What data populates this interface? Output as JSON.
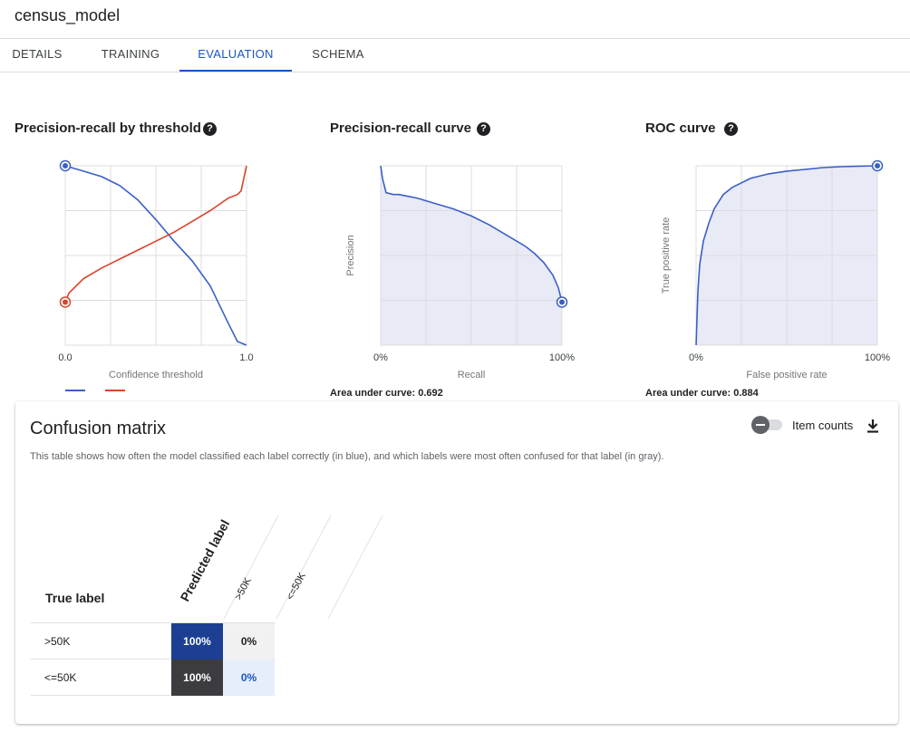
{
  "app": {
    "title": "census_model"
  },
  "tabs": [
    {
      "label": "DETAILS",
      "active": false
    },
    {
      "label": "TRAINING",
      "active": false
    },
    {
      "label": "EVALUATION",
      "active": true
    },
    {
      "label": "SCHEMA",
      "active": false
    }
  ],
  "charts": {
    "pr_threshold": {
      "title": "Precision-recall by threshold",
      "xlabel": "Confidence threshold",
      "x_min_label": "0.0",
      "x_max_label": "1.0",
      "legend_colors": [
        "#3b5fc6",
        "#d8442b"
      ]
    },
    "pr_curve": {
      "title": "Precision-recall curve",
      "xlabel": "Recall",
      "ylabel": "Precision",
      "x_min_label": "0%",
      "x_max_label": "100%",
      "auc_text": "Area under curve: 0.692"
    },
    "roc": {
      "title": "ROC curve",
      "xlabel": "False positive rate",
      "ylabel": "True positive rate",
      "x_min_label": "0%",
      "x_max_label": "100%",
      "auc_text": "Area under curve: 0.884"
    }
  },
  "chart_data": [
    {
      "type": "line",
      "title": "Precision-recall by threshold",
      "xlabel": "Confidence threshold",
      "xlim": [
        0,
        1
      ],
      "ylim": [
        0,
        1
      ],
      "grid": true,
      "series": [
        {
          "color": "#3b5fc6",
          "x": [
            0,
            0.1,
            0.2,
            0.3,
            0.4,
            0.5,
            0.6,
            0.7,
            0.8,
            0.9,
            0.95,
            1.0
          ],
          "y": [
            1.0,
            0.97,
            0.94,
            0.89,
            0.81,
            0.7,
            0.58,
            0.47,
            0.33,
            0.12,
            0.02,
            0.0
          ]
        },
        {
          "color": "#d8442b",
          "x": [
            0,
            0.02,
            0.1,
            0.2,
            0.3,
            0.4,
            0.5,
            0.6,
            0.7,
            0.8,
            0.9,
            0.95,
            0.97,
            1.0
          ],
          "y": [
            0.24,
            0.29,
            0.37,
            0.43,
            0.48,
            0.53,
            0.58,
            0.63,
            0.69,
            0.75,
            0.82,
            0.84,
            0.86,
            1.0
          ]
        }
      ]
    },
    {
      "type": "area",
      "title": "Precision-recall curve",
      "xlabel": "Recall",
      "ylabel": "Precision",
      "xlim": [
        0,
        100
      ],
      "ylim": [
        0,
        1
      ],
      "grid": true,
      "x": [
        0,
        1,
        3,
        7,
        10,
        15,
        20,
        30,
        40,
        50,
        60,
        70,
        80,
        85,
        90,
        95,
        98,
        100
      ],
      "y": [
        1.0,
        0.93,
        0.85,
        0.84,
        0.84,
        0.83,
        0.82,
        0.79,
        0.76,
        0.72,
        0.67,
        0.61,
        0.55,
        0.51,
        0.46,
        0.39,
        0.32,
        0.24
      ]
    },
    {
      "type": "area",
      "title": "ROC curve",
      "xlabel": "False positive rate",
      "ylabel": "True positive rate",
      "xlim": [
        0,
        100
      ],
      "ylim": [
        0,
        100
      ],
      "grid": true,
      "x": [
        0,
        1,
        2,
        4,
        7,
        10,
        15,
        20,
        30,
        40,
        50,
        60,
        70,
        80,
        90,
        100
      ],
      "y": [
        0,
        30,
        45,
        58,
        68,
        76,
        84,
        88,
        93,
        95.5,
        97,
        98,
        99,
        99.5,
        99.8,
        100
      ]
    }
  ],
  "confusion_matrix": {
    "title": "Confusion matrix",
    "description": "This table shows how often the model classified each label correctly (in blue), and which labels were most often confused for that label (in gray).",
    "item_counts_label": "Item counts",
    "true_label_header": "True label",
    "predicted_label_header": "Predicted label",
    "columns": [
      ">50K",
      "<=50K"
    ],
    "rows": [
      {
        "label": ">50K",
        "cells": [
          "100%",
          "0%"
        ]
      },
      {
        "label": "<=50K",
        "cells": [
          "100%",
          "0%"
        ]
      }
    ]
  },
  "colors": {
    "accent": "#1a55c6",
    "series_blue": "#3b5fc6",
    "series_red": "#d8442b",
    "area_fill": "#e8eaf6",
    "cell_correct": "#1c3f94",
    "cell_confused": "#3c3c40",
    "cell_zero": "#f1f1f1",
    "cell_zero_diag": "#e6edfb"
  }
}
